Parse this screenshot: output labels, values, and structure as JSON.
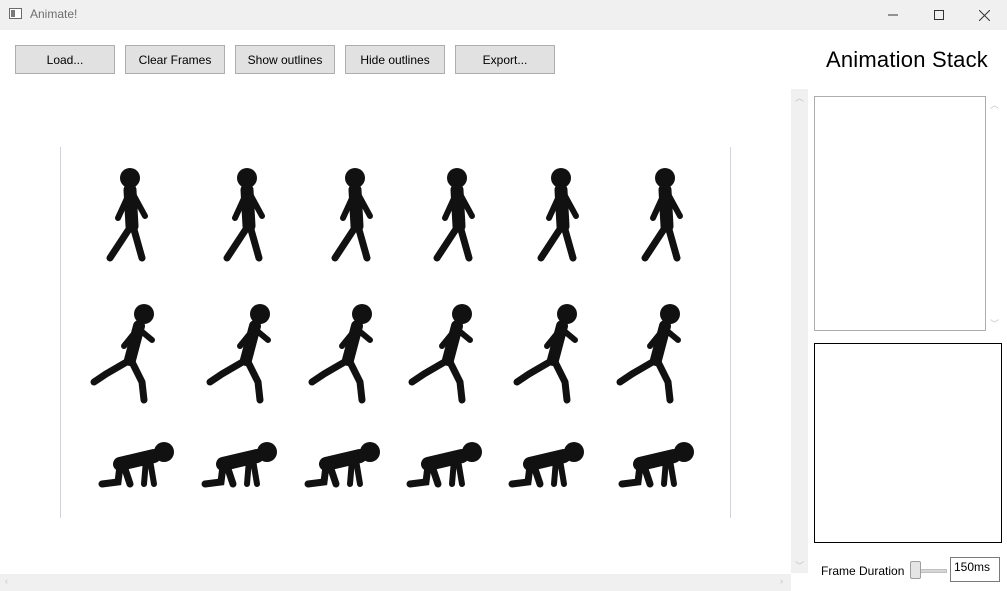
{
  "window": {
    "title": "Animate!",
    "minimize_icon": "minimize-icon",
    "maximize_icon": "maximize-icon",
    "close_icon": "close-icon"
  },
  "toolbar": {
    "load": "Load...",
    "clear_frames": "Clear Frames",
    "show_outlines": "Show outlines",
    "hide_outlines": "Hide outlines",
    "export": "Export..."
  },
  "stack": {
    "title": "Animation Stack"
  },
  "sprite_sheet": {
    "rows": [
      {
        "pose": "walking",
        "frames": 6
      },
      {
        "pose": "running",
        "frames": 6
      },
      {
        "pose": "crawling",
        "frames": 6
      }
    ]
  },
  "frame_duration": {
    "label": "Frame Duration",
    "value": "150ms"
  },
  "colors": {
    "figure": "#111111",
    "window_bg": "#f0f0f0",
    "button_bg": "#e1e1e1"
  }
}
